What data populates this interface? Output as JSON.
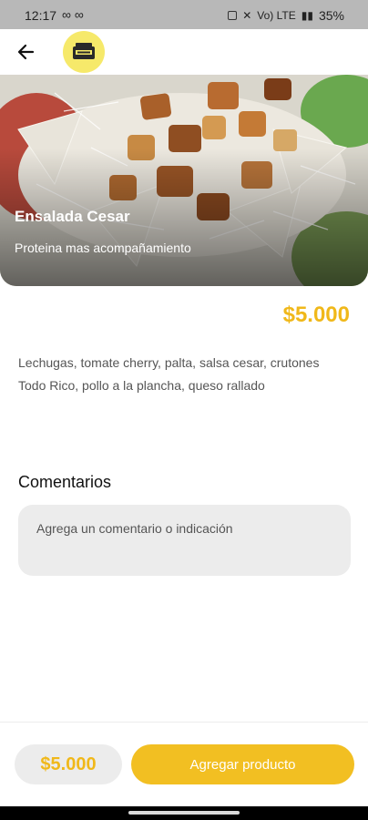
{
  "status_bar": {
    "time": "12:17",
    "loops": "∞ ∞",
    "signal_text": "Vo) LTE",
    "battery": "35%"
  },
  "app_bar": {
    "back_icon": "arrow-left-icon",
    "logo": "restaurant-logo"
  },
  "product": {
    "name": "Ensalada Cesar",
    "subtitle": "Proteina mas acompañamiento",
    "price": "$5.000",
    "description": "Lechugas, tomate cherry, palta, salsa cesar, crutones Todo Rico, pollo a la plancha, queso rallado"
  },
  "comments": {
    "label": "Comentarios",
    "placeholder": "Agrega un comentario o indicación"
  },
  "footer": {
    "total": "$5.000",
    "add_button_label": "Agregar producto"
  },
  "colors": {
    "accent": "#f2bf22",
    "price": "#f0b81a"
  }
}
